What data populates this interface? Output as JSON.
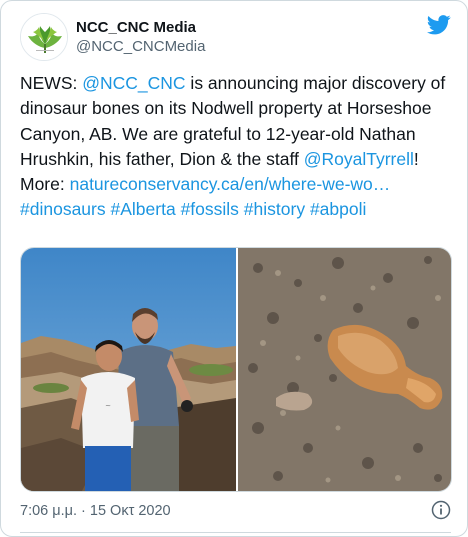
{
  "account": {
    "display_name": "NCC_CNC Media",
    "handle": "@NCC_CNCMedia",
    "avatar_icon": "ncc-maple-leaf-logo",
    "brand_color": "#5da73d"
  },
  "tweet": {
    "segments": [
      {
        "text": "NEWS: ",
        "type": "text"
      },
      {
        "text": "@NCC_CNC",
        "type": "mention"
      },
      {
        "text": " is announcing major discovery of dinosaur bones on its Nodwell property at Horseshoe Canyon, AB.  We are grateful to 12-year-old Nathan Hrushkin, his father, Dion & the staff ",
        "type": "text"
      },
      {
        "text": "@RoyalTyrrell",
        "type": "mention"
      },
      {
        "text": "! More: ",
        "type": "text"
      },
      {
        "text": "natureconservancy.ca/en/where-we-wo…",
        "type": "link"
      },
      {
        "text": " ",
        "type": "text"
      },
      {
        "text": "#dinosaurs",
        "type": "hashtag"
      },
      {
        "text": " ",
        "type": "text"
      },
      {
        "text": "#Alberta",
        "type": "hashtag"
      },
      {
        "text": " ",
        "type": "text"
      },
      {
        "text": "#fossils",
        "type": "hashtag"
      },
      {
        "text": " ",
        "type": "text"
      },
      {
        "text": "#history",
        "type": "hashtag"
      },
      {
        "text": " ",
        "type": "text"
      },
      {
        "text": "#abpoli",
        "type": "hashtag"
      }
    ],
    "link_color": "#1b95e0",
    "timestamp": "7:06 μ.μ. · 15 Οκτ 2020"
  },
  "media": {
    "left_photo": "boy-and-father-photo",
    "right_photo": "fossil-bones-photo"
  },
  "icons": {
    "twitter": "twitter-bird-icon",
    "info": "info-icon"
  }
}
